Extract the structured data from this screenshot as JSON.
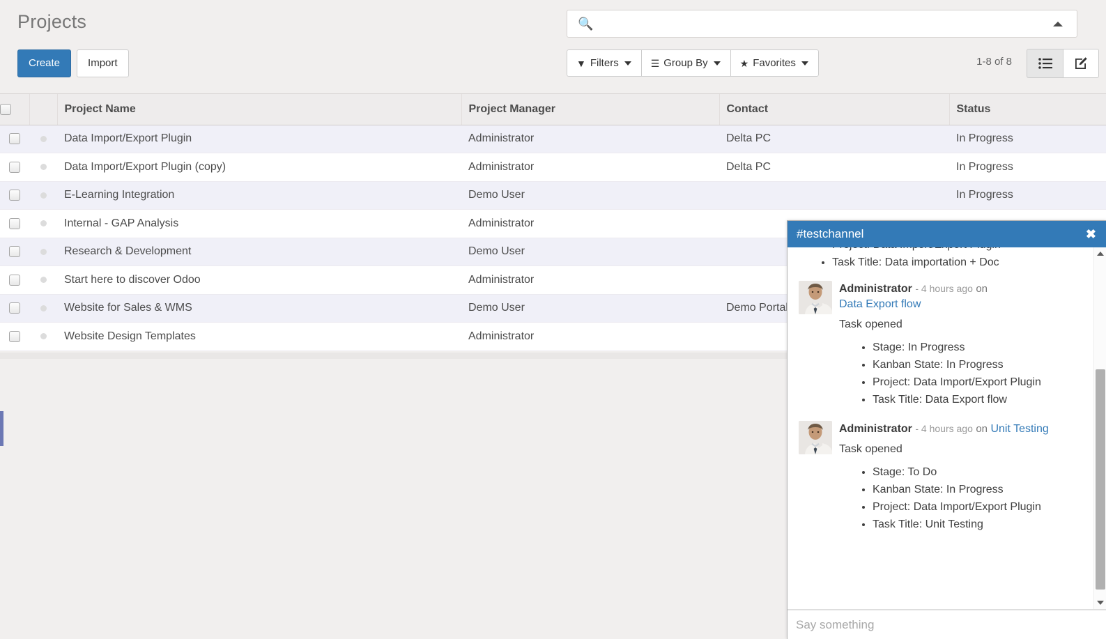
{
  "header": {
    "title": "Projects",
    "create_label": "Create",
    "import_label": "Import",
    "search": {
      "value": "",
      "placeholder": "",
      "icon": "search-icon",
      "toggle_icon": "caret-up-icon"
    },
    "filters": [
      {
        "label": "Filters",
        "icon": "funnel-icon"
      },
      {
        "label": "Group By",
        "icon": "hamburger-icon"
      },
      {
        "label": "Favorites",
        "icon": "star-icon"
      }
    ],
    "pager": "1-8 of 8",
    "views": [
      {
        "name": "list-view",
        "icon": "list-icon",
        "active": true
      },
      {
        "name": "form-view",
        "icon": "pencil-square-icon",
        "active": false
      }
    ]
  },
  "list": {
    "columns": [
      "Project Name",
      "Project Manager",
      "Contact",
      "Status"
    ],
    "rows": [
      {
        "name": "Data Import/Export Plugin",
        "manager": "Administrator",
        "contact": "Delta PC",
        "status": "In Progress"
      },
      {
        "name": "Data Import/Export Plugin (copy)",
        "manager": "Administrator",
        "contact": "Delta PC",
        "status": "In Progress"
      },
      {
        "name": "E-Learning Integration",
        "manager": "Demo User",
        "contact": "",
        "status": "In Progress"
      },
      {
        "name": "Internal - GAP Analysis",
        "manager": "Administrator",
        "contact": "",
        "status": ""
      },
      {
        "name": "Research & Development",
        "manager": "Demo User",
        "contact": "",
        "status": ""
      },
      {
        "name": "Start here to discover Odoo",
        "manager": "Administrator",
        "contact": "",
        "status": ""
      },
      {
        "name": "Website for Sales & WMS",
        "manager": "Demo User",
        "contact": "Demo Portal",
        "status": ""
      },
      {
        "name": "Website Design Templates",
        "manager": "Administrator",
        "contact": "",
        "status": ""
      }
    ]
  },
  "chat": {
    "title": "#testchannel",
    "close_label": "✖",
    "partial_message": {
      "bullets": [
        "Project: Data Import/Export Plugin",
        "Task Title: Data importation + Doc"
      ]
    },
    "messages": [
      {
        "author": "Administrator",
        "date": "- 4 hours ago",
        "on": "on",
        "record": "Data Export flow",
        "record_inline": false,
        "text": "Task opened",
        "bullets": [
          "Stage: In Progress",
          "Kanban State: In Progress",
          "Project: Data Import/Export Plugin",
          "Task Title: Data Export flow"
        ]
      },
      {
        "author": "Administrator",
        "date": "- 4 hours ago",
        "on": "on",
        "record": "Unit Testing",
        "record_inline": true,
        "text": "Task opened",
        "bullets": [
          "Stage: To Do",
          "Kanban State: In Progress",
          "Project: Data Import/Export Plugin",
          "Task Title: Unit Testing"
        ]
      }
    ],
    "composer": {
      "value": "",
      "placeholder": "Say something"
    }
  },
  "colors": {
    "primary": "#337ab7",
    "header_bg": "#f1efee",
    "row_odd": "#f0f0f8",
    "link": "#337ab7"
  }
}
